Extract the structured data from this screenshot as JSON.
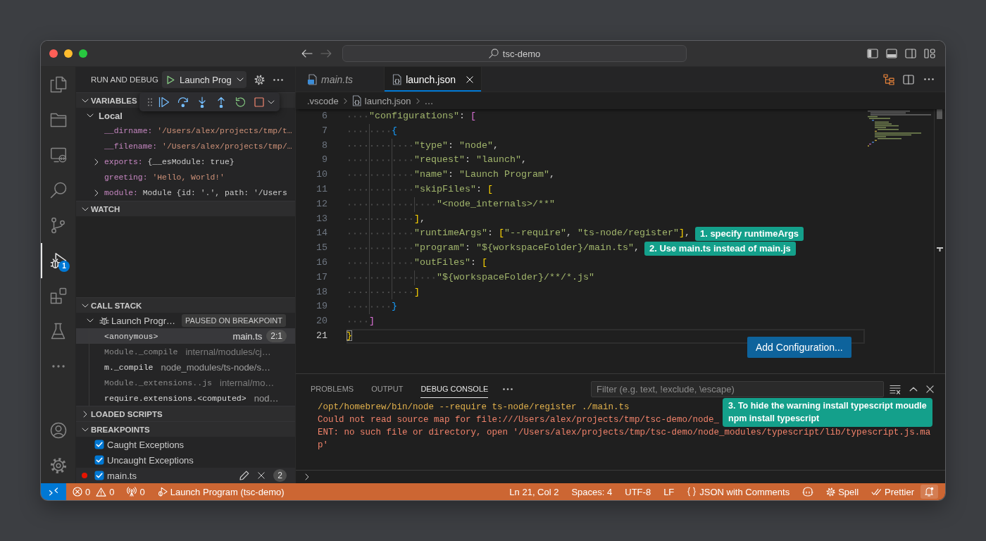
{
  "window": {
    "title": "tsc-demo"
  },
  "activity_bar": {
    "items": [
      {
        "kind": "explorer",
        "selected": false
      },
      {
        "kind": "folder",
        "selected": false
      },
      {
        "kind": "remote",
        "selected": false
      },
      {
        "kind": "search",
        "selected": false
      },
      {
        "kind": "source_control",
        "selected": false
      },
      {
        "kind": "run_debug",
        "selected": true,
        "badge": "1"
      },
      {
        "kind": "extensions",
        "selected": false
      },
      {
        "kind": "testing",
        "selected": false
      },
      {
        "kind": "more",
        "selected": false
      }
    ],
    "bottom_items": [
      {
        "kind": "account"
      },
      {
        "kind": "settings"
      }
    ]
  },
  "sidebar": {
    "title": "RUN AND DEBUG",
    "launch_config": "Launch Prog",
    "sections": [
      {
        "kind": "variables",
        "title": "VARIABLES",
        "expanded": true,
        "scopes": [
          {
            "name": "Local",
            "expanded": true,
            "variables": [
              {
                "label": "__dirname:",
                "value": "'/Users/alex/projects/tmp/t…",
                "kind": "string",
                "expandable": false
              },
              {
                "label": "__filename:",
                "value": "'/Users/alex/projects/tmp/…",
                "kind": "string",
                "expandable": false
              },
              {
                "label": "exports:",
                "value": "{__esModule: true}",
                "kind": "object",
                "expandable": true
              },
              {
                "label": "greeting:",
                "value": "'Hello, World!'",
                "kind": "string",
                "expandable": false
              },
              {
                "label": "module:",
                "value": "Module {id: '.', path: '/Users",
                "kind": "object",
                "expandable": true
              }
            ]
          }
        ]
      },
      {
        "kind": "watch",
        "title": "WATCH",
        "expanded": true
      },
      {
        "kind": "call_stack",
        "title": "CALL STACK",
        "expanded": true,
        "sessions": [
          {
            "name": "Launch Progr…",
            "status": "PAUSED ON BREAKPOINT",
            "expanded": true,
            "frames": [
              {
                "function": "<anonymous>",
                "file": "main.ts",
                "position": "2:1",
                "selected": true,
                "dimmed": false
              },
              {
                "function": "Module._compile",
                "file": "internal/modules/cj…",
                "selected": false,
                "dimmed": true
              },
              {
                "function": "m._compile",
                "file": "node_modules/ts-node/s…",
                "selected": false,
                "dimmed": false
              },
              {
                "function": "Module._extensions..js",
                "file": "internal/mo…",
                "selected": false,
                "dimmed": true
              },
              {
                "function": "require.extensions.<computed>",
                "file": "nod…",
                "selected": false,
                "dimmed": false
              }
            ]
          }
        ]
      },
      {
        "kind": "loaded_scripts",
        "title": "LOADED SCRIPTS",
        "expanded": false
      },
      {
        "kind": "breakpoints",
        "title": "BREAKPOINTS",
        "expanded": true,
        "items": [
          {
            "kind": "exception",
            "label": "Caught Exceptions",
            "checked": true,
            "hovered": false
          },
          {
            "kind": "exception",
            "label": "Uncaught Exceptions",
            "checked": true,
            "hovered": false
          },
          {
            "kind": "file",
            "label": "main.ts",
            "checked": true,
            "hovered": true,
            "line": "2"
          }
        ]
      }
    ]
  },
  "editor": {
    "tabs": [
      {
        "label": "main.ts",
        "kind": "typescript",
        "selected": false,
        "preview": true
      },
      {
        "label": "launch.json",
        "kind": "json",
        "selected": true,
        "preview": false
      }
    ],
    "breadcrumbs": [
      {
        "label": ".vscode",
        "kind": "folder"
      },
      {
        "label": "launch.json",
        "kind": "json"
      },
      {
        "label": "…",
        "kind": "symbol"
      }
    ],
    "lines": [
      {
        "number": "6",
        "current": false,
        "tokens": [
          {
            "kind": "string",
            "text": "    \"configurations\""
          },
          {
            "kind": "punct",
            "text": ": "
          },
          {
            "kind": "bracket",
            "text": "[",
            "color": "#da70d6"
          }
        ]
      },
      {
        "number": "7",
        "current": false,
        "tokens": [
          {
            "kind": "bracket",
            "text": "        {",
            "color": "#179fff"
          }
        ]
      },
      {
        "number": "8",
        "current": false,
        "tokens": [
          {
            "kind": "string",
            "text": "            \"type\""
          },
          {
            "kind": "punct",
            "text": ": "
          },
          {
            "kind": "string",
            "text": "\"node\""
          },
          {
            "kind": "punct",
            "text": ","
          }
        ]
      },
      {
        "number": "9",
        "current": false,
        "tokens": [
          {
            "kind": "string",
            "text": "            \"request\""
          },
          {
            "kind": "punct",
            "text": ": "
          },
          {
            "kind": "string",
            "text": "\"launch\""
          },
          {
            "kind": "punct",
            "text": ","
          }
        ]
      },
      {
        "number": "10",
        "current": false,
        "tokens": [
          {
            "kind": "string",
            "text": "            \"name\""
          },
          {
            "kind": "punct",
            "text": ": "
          },
          {
            "kind": "string",
            "text": "\"Launch Program\""
          },
          {
            "kind": "punct",
            "text": ","
          }
        ]
      },
      {
        "number": "11",
        "current": false,
        "tokens": [
          {
            "kind": "string",
            "text": "            \"skipFiles\""
          },
          {
            "kind": "punct",
            "text": ": "
          },
          {
            "kind": "bracket",
            "text": "[",
            "color": "#ffd700"
          }
        ]
      },
      {
        "number": "12",
        "current": false,
        "tokens": [
          {
            "kind": "string",
            "text": "                \"<node_internals>/**\""
          }
        ]
      },
      {
        "number": "13",
        "current": false,
        "tokens": [
          {
            "kind": "bracket",
            "text": "            ]",
            "color": "#ffd700"
          },
          {
            "kind": "punct",
            "text": ","
          }
        ]
      },
      {
        "number": "14",
        "current": false,
        "callout": "1. specify runtimeArgs",
        "tokens": [
          {
            "kind": "string",
            "text": "            \"runtimeArgs\""
          },
          {
            "kind": "punct",
            "text": ": "
          },
          {
            "kind": "bracket",
            "text": "[",
            "color": "#ffd700"
          },
          {
            "kind": "string",
            "text": "\"--require\""
          },
          {
            "kind": "punct",
            "text": ", "
          },
          {
            "kind": "string",
            "text": "\"ts-node/register\""
          },
          {
            "kind": "bracket",
            "text": "]",
            "color": "#ffd700"
          },
          {
            "kind": "punct",
            "text": ","
          }
        ]
      },
      {
        "number": "15",
        "current": false,
        "callout": "2. Use main.ts instead of main.js",
        "tokens": [
          {
            "kind": "string",
            "text": "            \"program\""
          },
          {
            "kind": "punct",
            "text": ": "
          },
          {
            "kind": "string",
            "text": "\"${workspaceFolder}/main.ts\""
          },
          {
            "kind": "punct",
            "text": ","
          }
        ]
      },
      {
        "number": "16",
        "current": false,
        "tokens": [
          {
            "kind": "string",
            "text": "            \"outFiles\""
          },
          {
            "kind": "punct",
            "text": ": "
          },
          {
            "kind": "bracket",
            "text": "[",
            "color": "#ffd700"
          }
        ]
      },
      {
        "number": "17",
        "current": false,
        "tokens": [
          {
            "kind": "string",
            "text": "                \"${workspaceFolder}/**/*.js\""
          }
        ]
      },
      {
        "number": "18",
        "current": false,
        "tokens": [
          {
            "kind": "bracket",
            "text": "            ]",
            "color": "#ffd700"
          }
        ]
      },
      {
        "number": "19",
        "current": false,
        "tokens": [
          {
            "kind": "bracket",
            "text": "        }",
            "color": "#179fff"
          }
        ]
      },
      {
        "number": "20",
        "current": false,
        "tokens": [
          {
            "kind": "bracket",
            "text": "    ]",
            "color": "#da70d6"
          }
        ]
      },
      {
        "number": "21",
        "current": true,
        "tokens": [
          {
            "kind": "bracket",
            "text": "}",
            "color": "#ffd700"
          }
        ]
      }
    ],
    "add_configuration": "Add Configuration..."
  },
  "panel": {
    "tabs": [
      {
        "label": "PROBLEMS",
        "selected": false
      },
      {
        "label": "OUTPUT",
        "selected": false
      },
      {
        "label": "DEBUG CONSOLE",
        "selected": true
      }
    ],
    "filter_placeholder": "Filter (e.g. text, !exclude, \\escape)",
    "console": [
      {
        "kind": "command",
        "text": "/opt/homebrew/bin/node --require ts-node/register ./main.ts"
      },
      {
        "kind": "error",
        "text": "Could not read source map for file:///Users/alex/projects/tmp/tsc-demo/node_"
      },
      {
        "kind": "error",
        "text": "ENT: no such file or directory, open '/Users/alex/projects/tmp/tsc-demo/node_modules/typescript/lib/typescript.js.ma"
      },
      {
        "kind": "error",
        "text": "p'"
      }
    ],
    "callout": "3. To hide the warning install typescript moudle\nnpm install typescript"
  },
  "status_bar": {
    "left": [
      {
        "kind": "remote"
      },
      {
        "kind": "problems",
        "errors": "0",
        "warnings": "0"
      },
      {
        "kind": "ports",
        "text": "0"
      },
      {
        "kind": "debug",
        "text": "Launch Program (tsc-demo)"
      }
    ],
    "right": [
      {
        "kind": "text",
        "text": "Ln 21, Col 2"
      },
      {
        "kind": "text",
        "text": "Spaces: 4"
      },
      {
        "kind": "text",
        "text": "UTF-8"
      },
      {
        "kind": "text",
        "text": "LF"
      },
      {
        "kind": "language",
        "text": "JSON with Comments"
      },
      {
        "kind": "assistant"
      },
      {
        "kind": "spell",
        "text": "Spell"
      },
      {
        "kind": "prettier",
        "text": "Prettier"
      },
      {
        "kind": "notifications"
      }
    ]
  }
}
